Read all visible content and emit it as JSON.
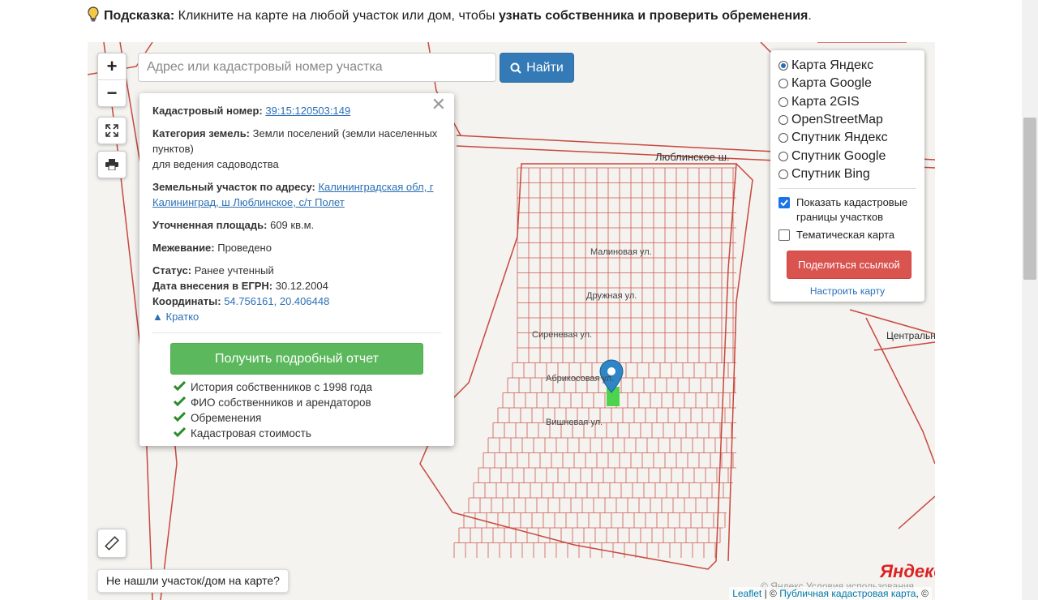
{
  "hint": {
    "label": "Подсказка:",
    "text_before": " Кликните на карте на любой участок или дом, чтобы ",
    "text_bold": "узнать собственника и проверить обременения",
    "text_after": "."
  },
  "map_controls": {
    "zoom_in": "+",
    "zoom_out": "−"
  },
  "search": {
    "placeholder": "Адрес или кадастровый номер участка",
    "button": "Найти"
  },
  "popup": {
    "cadastral_label": "Кадастровый номер:",
    "cadastral_value": "39:15:120503:149",
    "category_label": "Категория земель:",
    "category_value": " Земли поселений (земли населенных пунктов)",
    "usage": "для ведения садоводства",
    "address_label": "Земельный участок по адресу:",
    "address_value": "Калининградская обл, г Калининград, ш Люблинское, с/т Полет",
    "area_label": "Уточненная площадь:",
    "area_value": " 609 кв.м.",
    "survey_label": "Межевание:",
    "survey_value": " Проведено",
    "status_label": "Статус:",
    "status_value": " Ранее учтенный",
    "egrn_label": "Дата внесения в ЕГРН:",
    "egrn_value": " 30.12.2004",
    "coords_label": "Координаты:",
    "coords_value": "54.756161, 20.406448",
    "collapse": "Кратко",
    "report_button": "Получить подробный отчет",
    "features": [
      "История собственников с 1998 года",
      "ФИО собственников и арендаторов",
      "Обременения",
      "Кадастровая стоимость"
    ]
  },
  "layers": {
    "options": [
      {
        "label": "Карта Яндекс",
        "selected": true
      },
      {
        "label": "Карта Google",
        "selected": false
      },
      {
        "label": "Карта 2GIS",
        "selected": false
      },
      {
        "label": "OpenStreetMap",
        "selected": false
      },
      {
        "label": "Спутник Яндекс",
        "selected": false
      },
      {
        "label": "Спутник Google",
        "selected": false
      },
      {
        "label": "Спутник Bing",
        "selected": false
      }
    ],
    "show_cadastral": "Показать кадастровые границы участков",
    "thematic": "Тематическая карта",
    "share_button": "Поделиться ссылкой",
    "configure": "Настроить карту"
  },
  "map_labels": {
    "road": "Люблинское ш.",
    "streets": [
      "Малиновая ул.",
      "Дружная ул.",
      "Сиреневая ул.",
      "Абрикосовая ул.",
      "Вишневая ул."
    ],
    "logo": "Яндекс",
    "terms": "© Яндекс  Условия использования",
    "right_label": "Центральн"
  },
  "not_found": "Не нашли участок/дом на карте?",
  "attribution": {
    "leaflet": "Leaflet",
    "sep": " | © ",
    "pkk": "Публичная кадастровая карта",
    "tail": ", ©"
  },
  "colors": {
    "accent_blue": "#337ab7",
    "report_green": "#5cb85c",
    "share_red": "#d9534f",
    "parcel_red": "#c8483e"
  }
}
